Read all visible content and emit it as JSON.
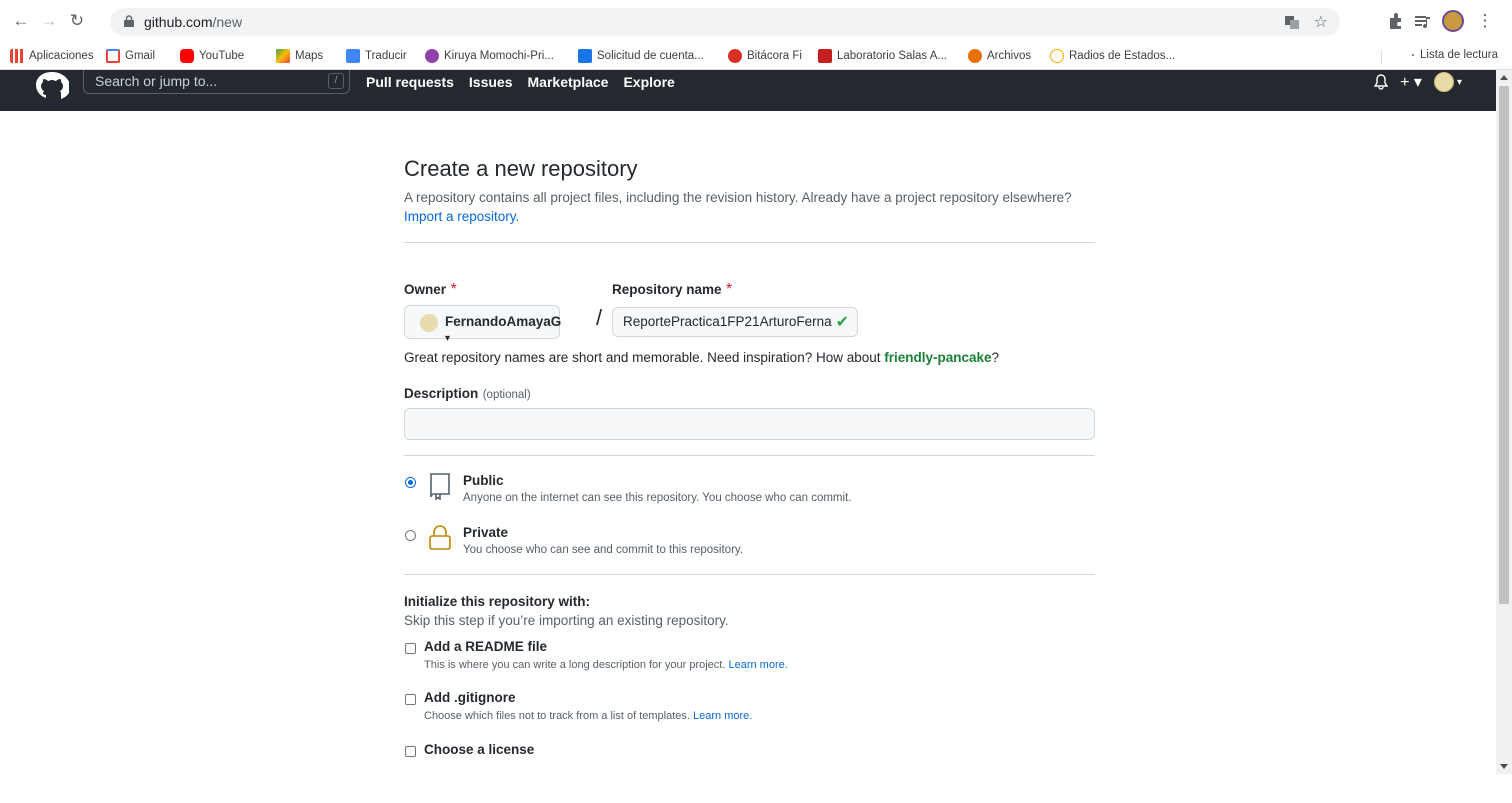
{
  "browser": {
    "url_host": "github.com",
    "url_path": "/new",
    "bookmarks": [
      {
        "label": "Aplicaciones",
        "icon": "apps-grid-icon",
        "color": "#4285f4"
      },
      {
        "label": "Gmail",
        "icon": "gmail-icon",
        "color": "#ea4335"
      },
      {
        "label": "YouTube",
        "icon": "youtube-icon",
        "color": "#ff0000"
      },
      {
        "label": "Maps",
        "icon": "maps-icon",
        "color": "#34a853"
      },
      {
        "label": "Traducir",
        "icon": "translate-icon",
        "color": "#4285f4"
      },
      {
        "label": "Kiruya Momochi-Pri...",
        "icon": "kiruya-icon",
        "color": "#8e44ad"
      },
      {
        "label": "Solicitud de cuenta...",
        "icon": "forms-icon",
        "color": "#1a73e8"
      },
      {
        "label": "Bitácora Fi",
        "icon": "bitacora-icon",
        "color": "#d93025"
      },
      {
        "label": "Laboratorio Salas A...",
        "icon": "lab-icon",
        "color": "#c5221f"
      },
      {
        "label": "Archivos",
        "icon": "archivos-icon",
        "color": "#e8710a"
      },
      {
        "label": "Radios de Estados...",
        "icon": "radios-icon",
        "color": "#f9ab00"
      }
    ],
    "reading_list": "Lista de lectura"
  },
  "header": {
    "search_placeholder": "Search or jump to...",
    "search_key": "/",
    "nav": [
      "Pull requests",
      "Issues",
      "Marketplace",
      "Explore"
    ]
  },
  "page": {
    "title": "Create a new repository",
    "subtitle": "A repository contains all project files, including the revision history. Already have a project repository elsewhere?",
    "import_link": "Import a repository.",
    "owner_label": "Owner",
    "owner_value": "FernandoAmayaG",
    "repo_label": "Repository name",
    "repo_value": "ReportePractica1FP21ArturoFerna",
    "required_mark": "*",
    "slash": "/",
    "hint_prefix": "Great repository names are short and memorable. Need inspiration? How about ",
    "hint_suggestion": "friendly-pancake",
    "hint_suffix": "?",
    "desc_label": "Description",
    "desc_optional": "(optional)",
    "public_title": "Public",
    "public_desc": "Anyone on the internet can see this repository. You choose who can commit.",
    "private_title": "Private",
    "private_desc": "You choose who can see and commit to this repository.",
    "init_title": "Initialize this repository with:",
    "init_note": "Skip this step if you’re importing an existing repository.",
    "readme_title": "Add a README file",
    "readme_desc": "This is where you can write a long description for your project.",
    "gitignore_title": "Add .gitignore",
    "gitignore_desc": "Choose which files not to track from a list of templates.",
    "license_title": "Choose a license",
    "learn_more": "Learn more."
  }
}
